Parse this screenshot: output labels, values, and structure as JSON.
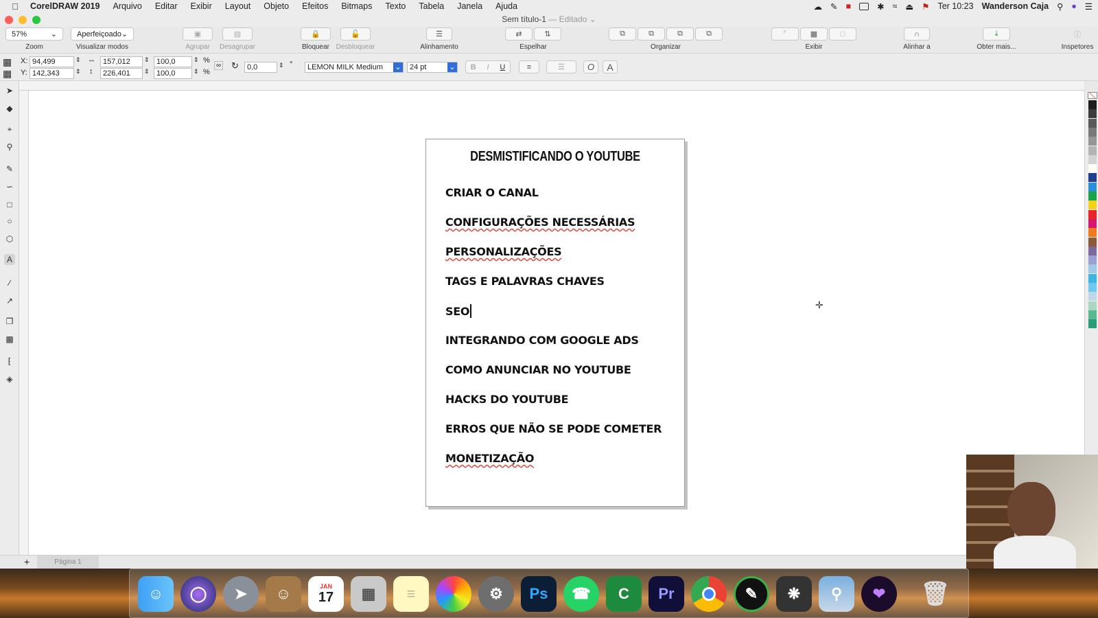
{
  "menubar": {
    "app_name": "CorelDRAW 2019",
    "items": [
      "Arquivo",
      "Editar",
      "Exibir",
      "Layout",
      "Objeto",
      "Efeitos",
      "Bitmaps",
      "Texto",
      "Tabela",
      "Janela",
      "Ajuda"
    ],
    "clock": "Ter 10:23",
    "user": "Wanderson Caja"
  },
  "window": {
    "title": "Sem título-1",
    "edited": "— Editado"
  },
  "toolbar": {
    "zoom_value": "57%",
    "zoom_label": "Zoom",
    "view_mode_value": "Aperfeiçoado",
    "view_mode_label": "Visualizar modos",
    "group_label": "Agrupar",
    "ungroup_label": "Desagrupar",
    "lock_label": "Bloquear",
    "unlock_label": "Desbloquear",
    "align_label": "Alinhamento",
    "mirror_label": "Espelhar",
    "arrange_label": "Organizar",
    "view_label": "Exibir",
    "snap_label": "Alinhar a",
    "get_more_label": "Obter mais...",
    "inspectors_label": "Inspetores"
  },
  "properties": {
    "x_label": "X:",
    "x": "94,499",
    "y_label": "Y:",
    "y": "142,343",
    "width": "157,012",
    "height": "226,401",
    "scale_w": "100,0",
    "scale_h": "100,0",
    "percent": "%",
    "rotation": "0,0",
    "degree": "°",
    "font": "LEMON MILK Medium",
    "font_size": "24 pt",
    "bold": "B",
    "italic": "I",
    "underline": "U"
  },
  "document": {
    "title": "DESMISTIFICANDO O YOUTUBE",
    "items": [
      "CRIAR O CANAL",
      "CONFIGURAÇÕES NECESSÁRIAS",
      "PERSONALIZAÇÕES",
      "TAGS E PALAVRAS CHAVES",
      "SEO",
      "INTEGRANDO COM GOOGLE ADS",
      "COMO ANUNCIAR NO YOUTUBE",
      "HACKS DO YOUTUBE",
      "ERROS QUE NÃO SE PODE COMETER",
      "MONETIZAÇÃO"
    ]
  },
  "page_tab": "Página 1",
  "dock": {
    "calendar_month": "JAN",
    "calendar_day": "17"
  },
  "colors": {
    "palette": [
      "#1e1e1e",
      "#3c3c3c",
      "#5a5a5a",
      "#787878",
      "#969696",
      "#b4b4b4",
      "#d2d2d2",
      "#ffffff",
      "#1f3f8f",
      "#2a8fd6",
      "#1aa34a",
      "#f2d21b",
      "#e8262a",
      "#d6176e",
      "#f07b1e",
      "#8a5a3a",
      "#7a6a9a",
      "#9aa0d0",
      "#a0c8e8",
      "#3cb5e0",
      "#6fc8f0",
      "#c0d8e8",
      "#a8d8c0",
      "#58b890",
      "#2a9c7a"
    ],
    "accent": "#2f6fd6"
  }
}
